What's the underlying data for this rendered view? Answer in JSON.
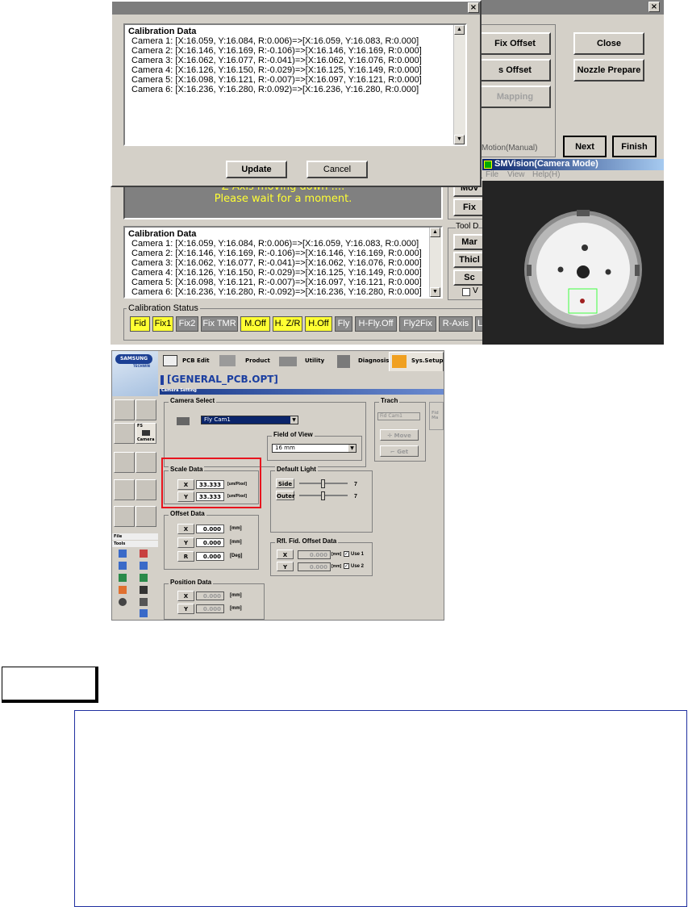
{
  "calib_dialog": {
    "close_glyph": "×",
    "title": "Calibration Data",
    "rows": [
      "Camera 1: [X:16.059, Y:16.084, R:0.006)=>[X:16.059, Y:16.083, R:0.000]",
      "Camera 2: [X:16.146, Y:16.169, R:-0.106)=>[X:16.146, Y:16.169, R:0.000]",
      "Camera 3: [X:16.062, Y:16.077, R:-0.041)=>[X:16.062, Y:16.076, R:0.000]",
      "Camera 4: [X:16.126, Y:16.150, R:-0.029)=>[X:16.125, Y:16.149, R:0.000]",
      "Camera 5: [X:16.098, Y:16.121, R:-0.007)=>[X:16.097, Y:16.121, R:0.000]",
      "Camera 6: [X:16.236, Y:16.280, R:0.092)=>[X:16.236, Y:16.280, R:0.000]"
    ],
    "update_label": "Update",
    "cancel_label": "Cancel"
  },
  "main_window": {
    "close_glyph": "×",
    "fix_offset_label": "Fix Offset",
    "s_offset_label": "s Offset",
    "mapping_label": "Mapping",
    "close_label": "Close",
    "nozzle_prepare_label": "Nozzle Prepare",
    "motion_manual_label": "Motion(Manual)",
    "next_label": "Next",
    "finish_label": "Finish",
    "message_line1": "Z Axis moving down ....",
    "message_line2": "Please wait for a moment.",
    "side_labels": [
      "Mov",
      "Fix"
    ],
    "tool_group_label": "Tool D",
    "tool_buttons": [
      "Mar",
      "Thicl",
      "Sc"
    ],
    "checkbox_label": "V",
    "calib_data_title": "Calibration Data",
    "calib_rows": [
      "Camera 1: [X:16.059, Y:16.084, R:0.006)=>[X:16.059, Y:16.083, R:0.000]",
      "Camera 2: [X:16.146, Y:16.169, R:-0.106)=>[X:16.146, Y:16.169, R:0.000]",
      "Camera 3: [X:16.062, Y:16.077, R:-0.041)=>[X:16.062, Y:16.076, R:0.000]",
      "Camera 4: [X:16.126, Y:16.150, R:-0.029)=>[X:16.125, Y:16.149, R:0.000]",
      "Camera 5: [X:16.098, Y:16.121, R:-0.007)=>[X:16.097, Y:16.121, R:0.000]",
      "Camera 6: [X:16.236, Y:16.280, R:-0.092)=>[X:16.236, Y:16.280, R:0.000]"
    ],
    "calib_status_title": "Calibration Status",
    "status_chips": [
      {
        "label": "Fid",
        "color": "#ffff33"
      },
      {
        "label": "Fix1",
        "color": "#ffff33"
      },
      {
        "label": "Fix2",
        "color": "#8a8a8a"
      },
      {
        "label": "Fix TMR",
        "color": "#8a8a8a"
      },
      {
        "label": "M.Off",
        "color": "#ffff33"
      },
      {
        "label": "H. Z/R",
        "color": "#ffff33"
      },
      {
        "label": "H.Off",
        "color": "#ffff33"
      },
      {
        "label": "Fly",
        "color": "#8a8a8a"
      },
      {
        "label": "H-Fly.Off",
        "color": "#8a8a8a"
      },
      {
        "label": "Fly2Fix",
        "color": "#8a8a8a"
      },
      {
        "label": "R-Axis",
        "color": "#8a8a8a"
      },
      {
        "label": "L",
        "color": "#8a8a8a"
      }
    ]
  },
  "vision_window": {
    "title": "SMVision(Camera Mode)",
    "menu": [
      "File",
      "View",
      "Help(H)"
    ]
  },
  "sys_setup": {
    "logo_text": "SAMSUNG",
    "logo_sub": "TECHWIN",
    "tabs": [
      "PCB Edit",
      "Product",
      "Utility",
      "Diagnosis",
      "Sys.Setup"
    ],
    "file_title": "[GENERAL_PCB.OPT]",
    "panel_title": "Camera Setting",
    "side_label_fs": "FS",
    "side_label_camera": "Camera",
    "file_label": "File",
    "tools_label": "Tools",
    "camera_select_label": "Camera Select",
    "camera_value": "Fly Cam1",
    "trach_label": "Trach",
    "trach_value": "Fid Cam1",
    "move_label": "Move",
    "get_label": "Get",
    "fid_label": "Fid",
    "ma_label": "Ma",
    "field_of_view_label": "Field of View",
    "fov_value": "16 mm",
    "scale_data_label": "Scale Data",
    "scale_x_label": "X",
    "scale_x_value": "33.333",
    "scale_y_label": "Y",
    "scale_y_value": "33.333",
    "scale_unit": "[um/Pixel]",
    "default_light_label": "Default Light",
    "side_light_label": "Side",
    "side_light_value": "7",
    "outer_light_label": "Outer",
    "outer_light_value": "7",
    "offset_data_label": "Offset Data",
    "offset_x_label": "X",
    "offset_x_value": "0.000",
    "offset_y_label": "Y",
    "offset_y_value": "0.000",
    "offset_r_label": "R",
    "offset_r_value": "0.000",
    "unit_mm": "[mm]",
    "unit_deg": "[Deg]",
    "ref_fid_label": "Rfl. Fid. Offset Data",
    "ref_x_label": "X",
    "ref_x_value": "0.000",
    "ref_y_label": "Y",
    "ref_y_value": "0.000",
    "use1_label": "Use 1",
    "use2_label": "Use 2",
    "position_data_label": "Position Data",
    "pos_x_label": "X",
    "pos_x_value": "0.000",
    "pos_y_label": "Y",
    "pos_y_value": "0.000",
    "highlight_color": "#e8141e"
  }
}
